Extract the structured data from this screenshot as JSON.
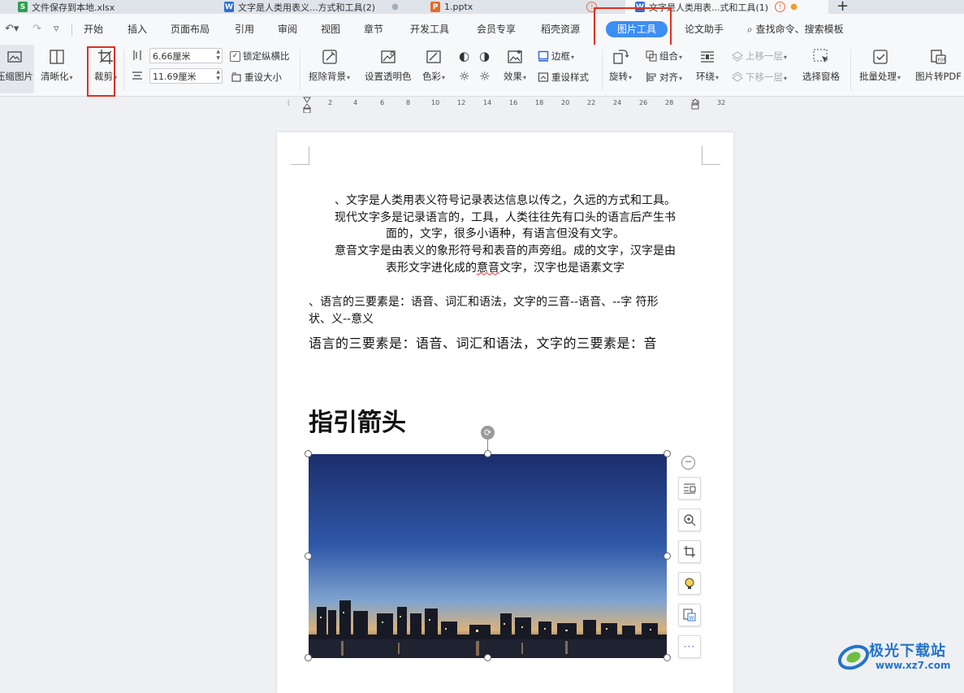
{
  "tabs": [
    {
      "name": "文件保存到本地.xlsx",
      "icon": "S",
      "color": "#2ba24c",
      "dot": ""
    },
    {
      "name": "文字是人类用表义...方式和工具(2)",
      "icon": "W",
      "color": "#2f6fd6",
      "dot": "●"
    },
    {
      "name": "1.pptx",
      "icon": "P",
      "color": "#e46c2c",
      "dot": ""
    },
    {
      "name": "文字是人类用表...式和工具(1)",
      "icon": "W",
      "color": "#2f6fd6",
      "dot": "●"
    }
  ],
  "new_tab": "+",
  "quick_access": {
    "undo": "↶▾",
    "redo": "↷",
    "more": "▿"
  },
  "menu": [
    "开始",
    "插入",
    "页面布局",
    "引用",
    "审阅",
    "视图",
    "章节",
    "开发工具",
    "会员专享",
    "稻壳资源",
    "图片工具",
    "论文助手"
  ],
  "menu_active": "图片工具",
  "search_cmd": "查找命令、搜索模板",
  "ribbon": {
    "compress": "压缩图片",
    "sharpen": "清晰化",
    "crop": "裁剪",
    "width": "6.66厘米",
    "height": "11.69厘米",
    "lock_ratio": "锁定纵横比",
    "lock_ratio_checked": true,
    "reset_size": "重设大小",
    "remove_bg": "抠除背景",
    "transparency": "设置透明色",
    "color": "色彩",
    "effects": "效果",
    "border": "边框",
    "reset_style": "重设样式",
    "rotate": "旋转",
    "group": "组合",
    "align": "对齐",
    "wrap": "环绕",
    "bring_forward": "上移一层",
    "send_backward": "下移一层",
    "selection_pane": "选择窗格",
    "batch": "批量处理",
    "to_pdf": "图片转PDF"
  },
  "ruler_ticks": [
    "2",
    "4",
    "6",
    "8",
    "10",
    "12",
    "14",
    "16",
    "18",
    "20",
    "22",
    "24",
    "26",
    "28",
    "30",
    "32"
  ],
  "doc": {
    "p1": [
      "、文字是人类用表义符号记录表达信息以传之，久远的方式和工具。",
      "现代文字多是记录语言的，工具，人类往往先有口头的语言后产生书",
      "面的，文字，很多小语种，有语言但没有文字。"
    ],
    "p2_a": "意音文字是由表义的象形符号和表音的声旁组。成的文字，汉字是由",
    "p2_b1": "表形文字进化成的",
    "p2_b2": "意音",
    "p2_b3": "文字，汉字也是语素文字",
    "p3": [
      "、语言的三要素是：语音、词汇和语法，文字的三音--语音、--字  符形",
      "状、义--意义"
    ],
    "p4": "语言的三要素是：语音、词汇和语法，文字的三要素是：音",
    "heading": "指引箭头"
  },
  "watermark": {
    "title": "极光下载站",
    "url": "www.xz7.com"
  }
}
